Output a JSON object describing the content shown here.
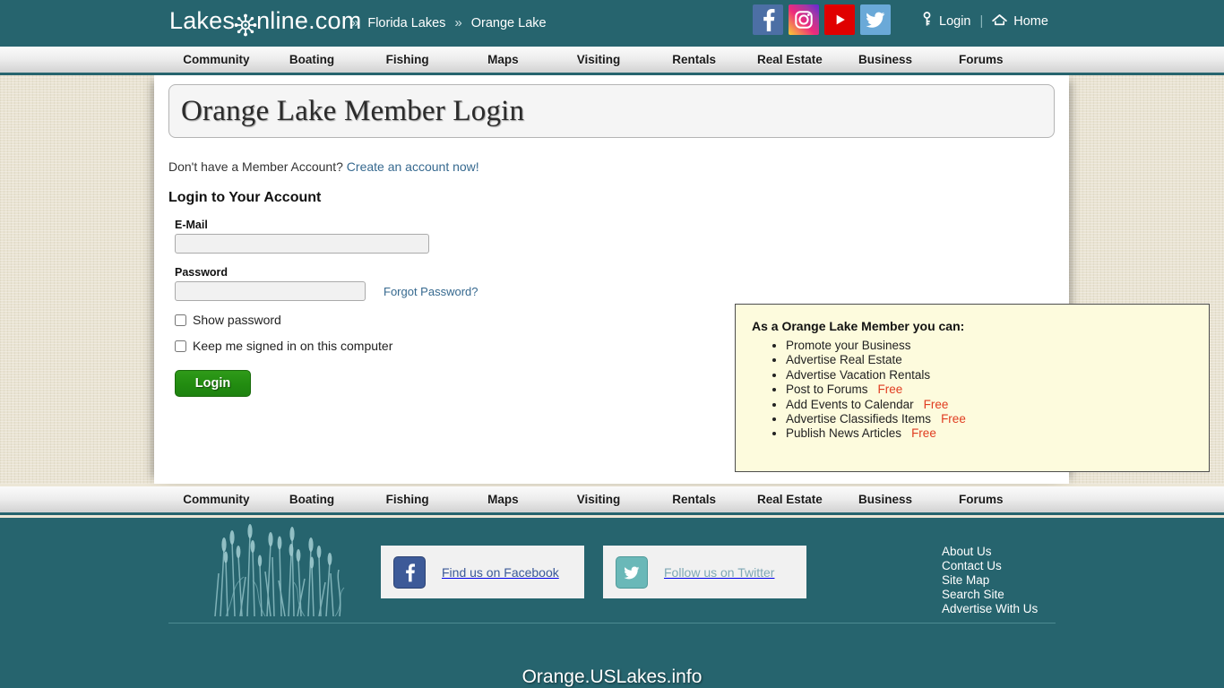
{
  "header": {
    "logo_text_left": "Lakes",
    "logo_text_right": "nline.com",
    "logo_icon": "ship-wheel-icon",
    "breadcrumb_sep": "»",
    "breadcrumb": [
      "Florida Lakes",
      "Orange Lake"
    ],
    "social": [
      {
        "name": "facebook-icon",
        "label": "Facebook"
      },
      {
        "name": "instagram-icon",
        "label": "Instagram"
      },
      {
        "name": "youtube-icon",
        "label": "YouTube"
      },
      {
        "name": "twitter-icon",
        "label": "Twitter"
      }
    ],
    "login_label": "Login",
    "divider": "|",
    "home_label": "Home"
  },
  "nav": {
    "items": [
      "Community",
      "Boating",
      "Fishing",
      "Maps",
      "Visiting",
      "Rentals",
      "Real Estate",
      "Business",
      "Forums"
    ]
  },
  "main": {
    "page_title": "Orange Lake Member Login",
    "no_account_text": "Don't have a Member Account?",
    "create_account_link": "Create an account now!",
    "section_heading": "Login to Your Account",
    "email_label": "E-Mail",
    "email_value": "",
    "email_placeholder": "",
    "password_label": "Password",
    "password_value": "",
    "password_placeholder": "",
    "forgot_password_link": "Forgot Password?",
    "show_password_label": "Show password",
    "keep_signed_in_label": "Keep me signed in on this computer",
    "login_button": "Login"
  },
  "benefits": {
    "heading": "As a Orange Lake Member you can:",
    "items": [
      {
        "text": "Promote your Business",
        "free": ""
      },
      {
        "text": "Advertise Real Estate",
        "free": ""
      },
      {
        "text": "Advertise Vacation Rentals",
        "free": ""
      },
      {
        "text": "Post to Forums",
        "free": "Free"
      },
      {
        "text": "Add Events to Calendar",
        "free": "Free"
      },
      {
        "text": "Advertise Classifieds Items",
        "free": "Free"
      },
      {
        "text": "Publish News Articles",
        "free": "Free"
      }
    ]
  },
  "footer": {
    "reeds_graphic": "cattail-reeds-graphic",
    "facebook_button": "Find us on Facebook",
    "twitter_button": "Follow us on Twitter",
    "links": [
      "About Us",
      "Contact Us",
      "Site Map",
      "Search Site",
      "Advertise With Us"
    ],
    "site_name": "Orange.USLakes.info"
  },
  "colors": {
    "teal": "#26646e",
    "link_blue": "#36698f",
    "free_red": "#e03c20",
    "login_green": "#228c10",
    "benefits_bg": "#fdfbdd",
    "page_bg": "#e9e3d2"
  }
}
